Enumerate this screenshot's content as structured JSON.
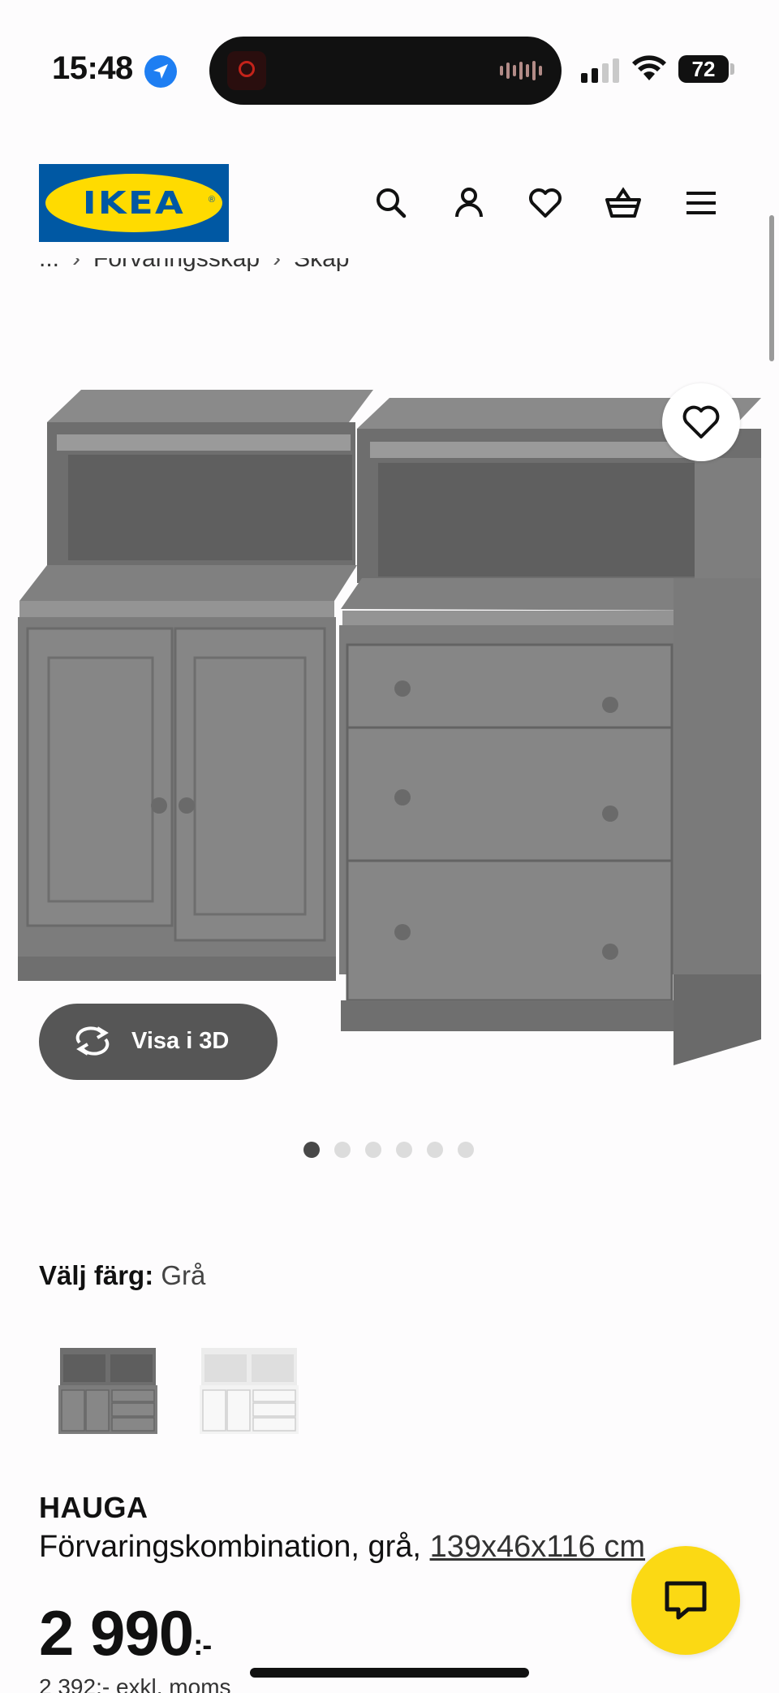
{
  "status_bar": {
    "time": "15:48",
    "battery": "72",
    "icons": [
      "location-arrow-icon",
      "signal-bars-icon",
      "wifi-icon",
      "battery-icon"
    ]
  },
  "header": {
    "logo_text": "IKEA",
    "logo_registered": "®",
    "icons": [
      "search-icon",
      "account-icon",
      "favourites-icon",
      "shopping-basket-icon",
      "menu-icon"
    ]
  },
  "breadcrumb": {
    "items": [
      "...",
      "Förvaringsskåp",
      "Skåp"
    ],
    "separator": "›"
  },
  "gallery": {
    "view_3d_label": "Visa i 3D",
    "slide_count": 6,
    "active_slide": 1
  },
  "color_picker": {
    "label": "Välj färg:",
    "selected": "Grå",
    "options": [
      "grey-variant",
      "white-variant"
    ]
  },
  "product": {
    "name": "HAUGA",
    "description": "Förvaringskombination, grå,",
    "dimensions": "139x46x116 cm",
    "price": "2 990",
    "price_suffix": ":-",
    "price_ex_vat": "2 392:- exkl. moms"
  },
  "colors": {
    "ikea_blue": "#0058a3",
    "ikea_yellow": "#ffdb00",
    "chat_yellow": "#fbd914",
    "furniture_grey": "#7c7c7c"
  }
}
